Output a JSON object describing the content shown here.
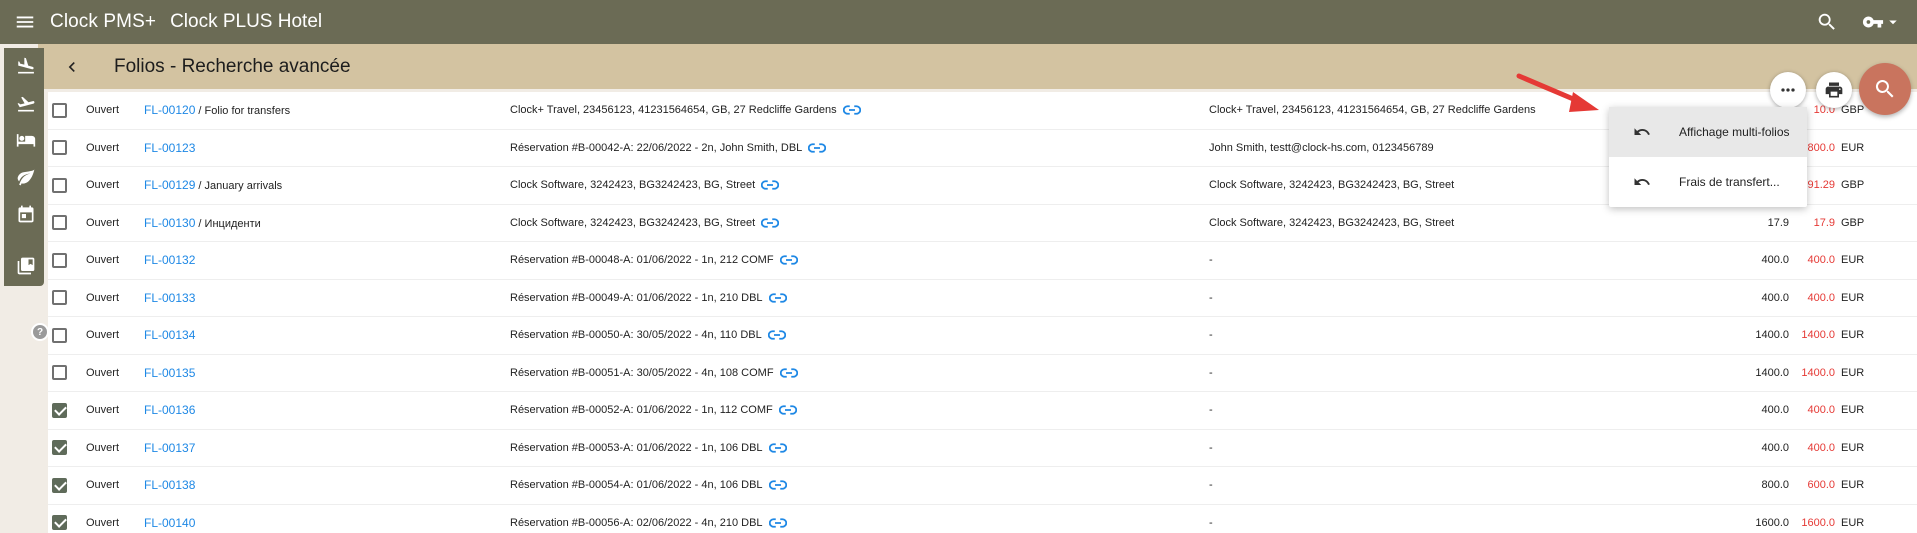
{
  "header": {
    "app_name": "Clock PMS+",
    "hotel_name": "Clock PLUS Hotel"
  },
  "subheader": {
    "title": "Folios - Recherche avancée"
  },
  "rows": [
    {
      "checked": false,
      "status": "Ouvert",
      "folio": "FL-00120",
      "suffix": " / Folio for transfers",
      "description": "Clock+ Travel, 23456123, 41231564654, GB, 27 Redcliffe Gardens",
      "payer": "Clock+ Travel, 23456123, 41231564654, GB, 27 Redcliffe Gardens",
      "amount1": "",
      "amount2": "10.0",
      "currency": "GBP"
    },
    {
      "checked": false,
      "status": "Ouvert",
      "folio": "FL-00123",
      "suffix": "",
      "description": "Réservation #B-00042-A: 22/06/2022 - 2n, John Smith, DBL",
      "payer": "John Smith, testt@clock-hs.com, 0123456789",
      "amount1": "",
      "amount2": "800.0",
      "currency": "EUR"
    },
    {
      "checked": false,
      "status": "Ouvert",
      "folio": "FL-00129",
      "suffix": " / January arrivals",
      "description": "Clock Software, 3242423, BG3242423, BG, Street",
      "payer": "Clock Software, 3242423, BG3242423, BG, Street",
      "amount1": "",
      "amount2": "391.29",
      "currency": "GBP"
    },
    {
      "checked": false,
      "status": "Ouvert",
      "folio": "FL-00130",
      "suffix": " / Инциденти",
      "description": "Clock Software, 3242423, BG3242423, BG, Street",
      "payer": "Clock Software, 3242423, BG3242423, BG, Street",
      "amount1": "17.9",
      "amount2": "17.9",
      "currency": "GBP"
    },
    {
      "checked": false,
      "status": "Ouvert",
      "folio": "FL-00132",
      "suffix": "",
      "description": "Réservation #B-00048-A: 01/06/2022 - 1n, 212 COMF",
      "payer": "-",
      "amount1": "400.0",
      "amount2": "400.0",
      "currency": "EUR"
    },
    {
      "checked": false,
      "status": "Ouvert",
      "folio": "FL-00133",
      "suffix": "",
      "description": "Réservation #B-00049-A: 01/06/2022 - 1n, 210 DBL",
      "payer": "-",
      "amount1": "400.0",
      "amount2": "400.0",
      "currency": "EUR"
    },
    {
      "checked": false,
      "status": "Ouvert",
      "folio": "FL-00134",
      "suffix": "",
      "description": "Réservation #B-00050-A: 30/05/2022 - 4n, 110 DBL",
      "payer": "-",
      "amount1": "1400.0",
      "amount2": "1400.0",
      "currency": "EUR"
    },
    {
      "checked": false,
      "status": "Ouvert",
      "folio": "FL-00135",
      "suffix": "",
      "description": "Réservation #B-00051-A: 30/05/2022 - 4n, 108 COMF",
      "payer": "-",
      "amount1": "1400.0",
      "amount2": "1400.0",
      "currency": "EUR"
    },
    {
      "checked": true,
      "status": "Ouvert",
      "folio": "FL-00136",
      "suffix": "",
      "description": "Réservation #B-00052-A: 01/06/2022 - 1n, 112 COMF",
      "payer": "-",
      "amount1": "400.0",
      "amount2": "400.0",
      "currency": "EUR"
    },
    {
      "checked": true,
      "status": "Ouvert",
      "folio": "FL-00137",
      "suffix": "",
      "description": "Réservation #B-00053-A: 01/06/2022 - 1n, 106 DBL",
      "payer": "-",
      "amount1": "400.0",
      "amount2": "400.0",
      "currency": "EUR"
    },
    {
      "checked": true,
      "status": "Ouvert",
      "folio": "FL-00138",
      "suffix": "",
      "description": "Réservation #B-00054-A: 01/06/2022 - 4n, 106 DBL",
      "payer": "-",
      "amount1": "800.0",
      "amount2": "600.0",
      "currency": "EUR"
    },
    {
      "checked": true,
      "status": "Ouvert",
      "folio": "FL-00140",
      "suffix": "",
      "description": "Réservation #B-00056-A: 02/06/2022 - 4n, 210 DBL",
      "payer": "-",
      "amount1": "1600.0",
      "amount2": "1600.0",
      "currency": "EUR"
    }
  ],
  "menu": {
    "items": [
      {
        "label": "Affichage multi-folios",
        "icon": "undo-icon"
      },
      {
        "label": "Frais de transfert...",
        "icon": "undo-icon"
      }
    ]
  },
  "colors": {
    "topbar": "#6b6b55",
    "subbar": "#d3c3a1",
    "link": "#1e88e5",
    "negative": "#e53935",
    "search_fab": "#c9745e",
    "arrow": "#e53935"
  }
}
